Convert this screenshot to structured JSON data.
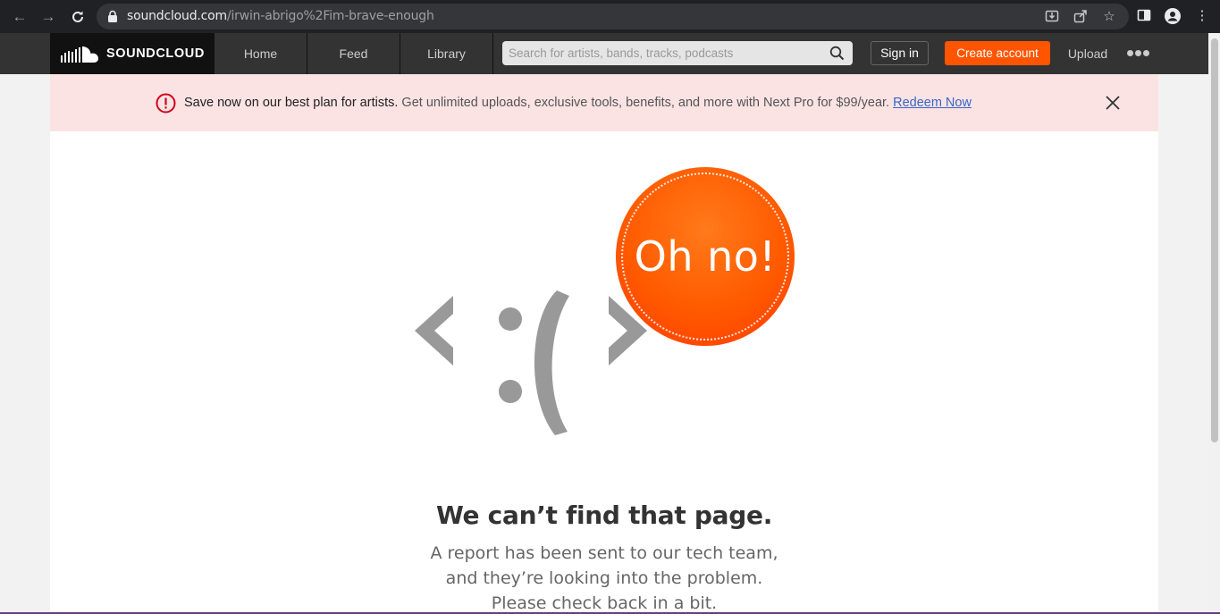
{
  "browser": {
    "url_host": "soundcloud.com",
    "url_path": "/irwin-abrigo%2Fim-brave-enough"
  },
  "header": {
    "logo_text": "SOUNDCLOUD",
    "nav": [
      "Home",
      "Feed",
      "Library"
    ],
    "search_placeholder": "Search for artists, bands, tracks, podcasts",
    "sign_in": "Sign in",
    "create_account": "Create account",
    "upload": "Upload"
  },
  "banner": {
    "bold": "Save now on our best plan for artists.",
    "text": " Get unlimited uploads, exclusive tools, benefits, and more with Next Pro for $99/year. ",
    "link": "Redeem Now"
  },
  "error": {
    "badge": "Oh no!",
    "heading": "We can’t find that page.",
    "lines": [
      "A report has been sent to our tech team,",
      "and they’re looking into the problem.",
      "Please check back in a bit."
    ]
  },
  "colors": {
    "accent": "#ff5500",
    "header_bg": "#333333",
    "banner_bg": "#fbe3e4",
    "link": "#3a66c4"
  }
}
